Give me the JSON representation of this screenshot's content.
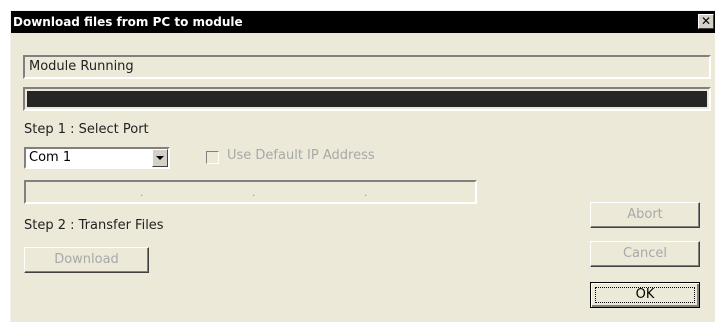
{
  "window": {
    "title": "Download files from PC to module",
    "close_glyph": "✕"
  },
  "status": {
    "text": "Module Running"
  },
  "progress": {
    "fraction": 1.0,
    "fill_color": "#262626"
  },
  "step1": {
    "label": "Step 1 : Select Port",
    "port_value": "Com 1",
    "use_default_ip_label": "Use Default IP Address",
    "use_default_ip_checked": false,
    "ip_separators": [
      ".",
      ".",
      "."
    ]
  },
  "step2": {
    "label": "Step 2 : Transfer Files",
    "download_label": "Download"
  },
  "buttons": {
    "abort": "Abort",
    "cancel": "Cancel",
    "ok": "OK"
  }
}
